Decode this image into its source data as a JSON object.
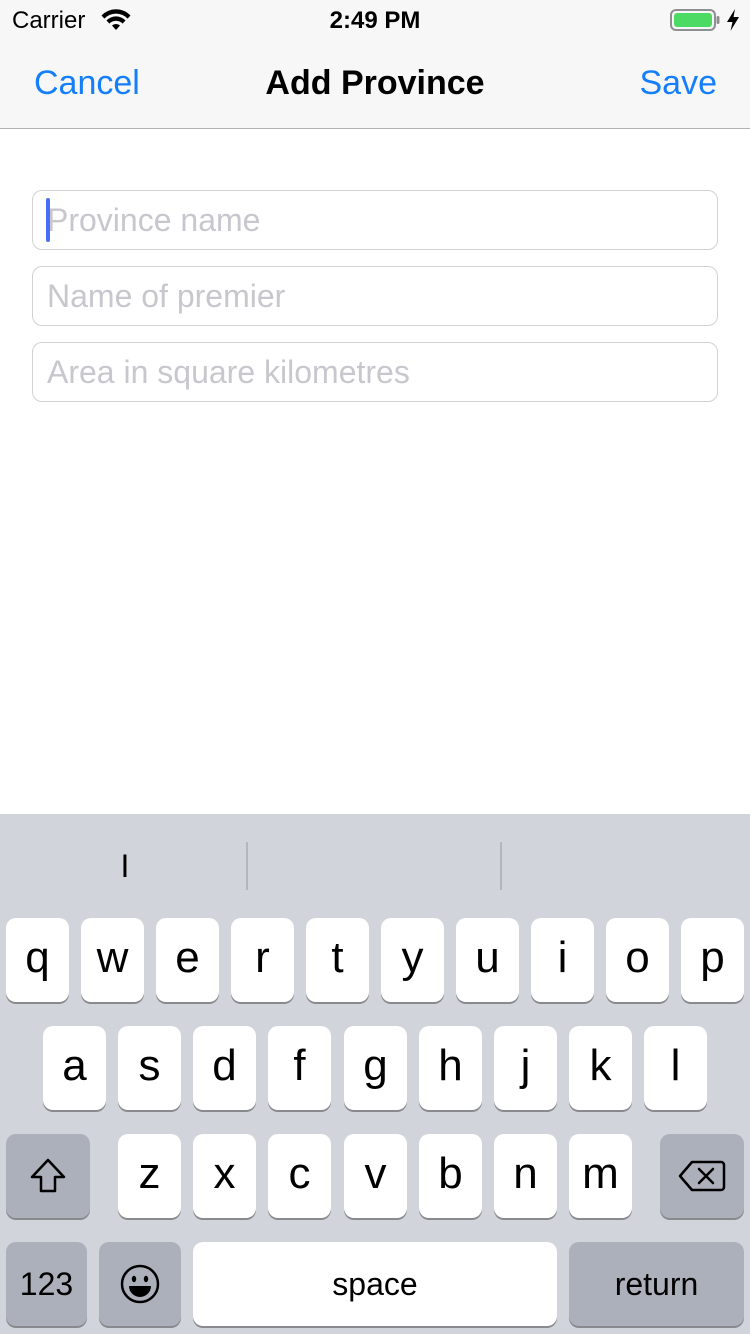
{
  "status_bar": {
    "carrier": "Carrier",
    "time": "2:49 PM",
    "battery_color": "#4cd964",
    "icons": [
      "wifi-icon",
      "battery-icon",
      "charging-bolt-icon"
    ]
  },
  "nav": {
    "cancel_label": "Cancel",
    "title": "Add Province",
    "save_label": "Save",
    "accent_color": "#147efb"
  },
  "form": {
    "province_name": {
      "value": "",
      "placeholder": "Province name",
      "focused": true
    },
    "premier_name": {
      "value": "",
      "placeholder": "Name of premier"
    },
    "area": {
      "value": "",
      "placeholder": "Area in square kilometres"
    }
  },
  "keyboard": {
    "suggestions": [
      "I",
      "",
      ""
    ],
    "row1": [
      "q",
      "w",
      "e",
      "r",
      "t",
      "y",
      "u",
      "i",
      "o",
      "p"
    ],
    "row2": [
      "a",
      "s",
      "d",
      "f",
      "g",
      "h",
      "j",
      "k",
      "l"
    ],
    "row3": [
      "z",
      "x",
      "c",
      "v",
      "b",
      "n",
      "m"
    ],
    "shift_icon": "shift-icon",
    "delete_icon": "delete-icon",
    "emoji_icon": "emoji-icon",
    "numbers_label": "123",
    "space_label": "space",
    "return_label": "return"
  }
}
